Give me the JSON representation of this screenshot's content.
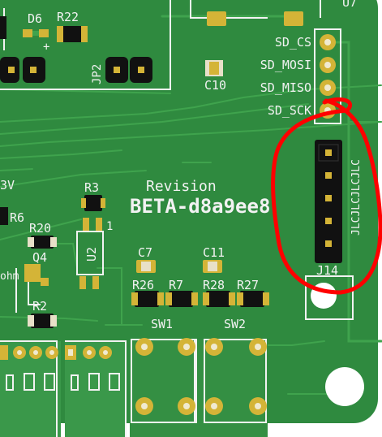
{
  "colors": {
    "board": "#2f8a3f",
    "copper_trace": "#3fa34d",
    "copper_pour": "#56b060",
    "silkscreen": "#f2f2f2",
    "pad_gold": "#d4b437",
    "pad_dark": "#111111",
    "annotation": "#ff0000",
    "background": "#ffffff"
  },
  "labels": {
    "top_right": "U7",
    "d6": "D6",
    "r22": "R22",
    "plus": "+",
    "jp2": "JP2",
    "c10": "C10",
    "sd_cs": "SD_CS",
    "sd_mosi": "SD_MOSI",
    "sd_miso": "SD_MISO",
    "sd_sck": "SD_SCK",
    "revision_title": "Revision",
    "revision_code": "BETA-d8a9ee8",
    "jlc": "JLCJLCJLCJLC",
    "j14": "J14",
    "r3": "R3",
    "u2": "U2",
    "pin1": "1",
    "left_3v": "3V",
    "r6": "R6",
    "r20": "R20",
    "q4": "Q4",
    "ohm": "ohm",
    "r2": "R2",
    "c7": "C7",
    "c11": "C11",
    "r26": "R26",
    "r7": "R7",
    "r28": "R28",
    "r27": "R27",
    "sw1": "SW1",
    "sw2": "SW2"
  }
}
